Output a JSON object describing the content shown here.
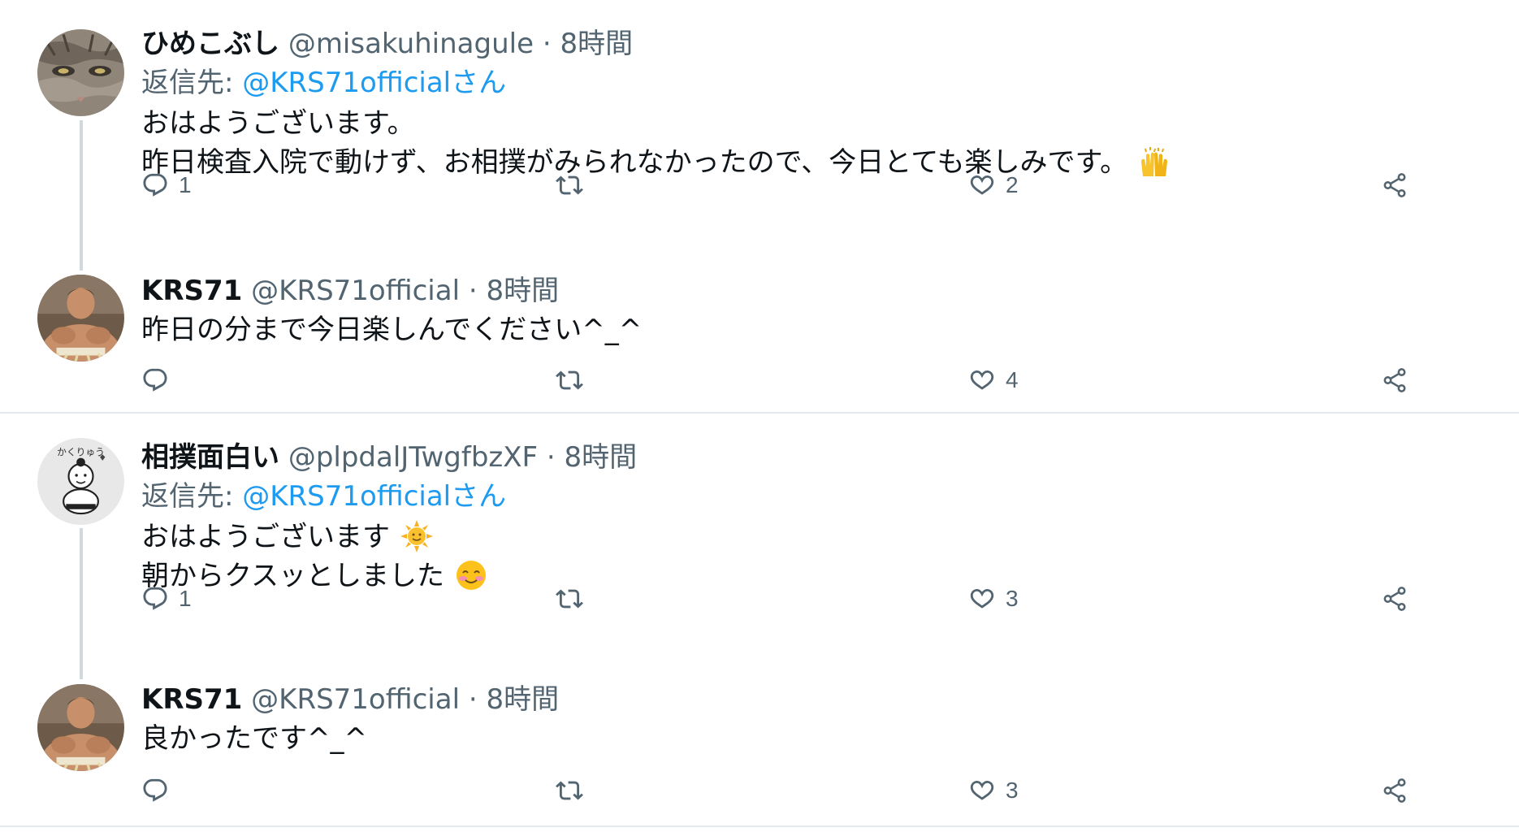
{
  "tweets": [
    {
      "name": "ひめこぶし",
      "handle": "@misakuhinagule",
      "sep": "·",
      "time": "8時間",
      "reply_prefix": "返信先: ",
      "reply_mention": "@KRS71officialさん",
      "lines": [
        "おはようございます。",
        "昨日検査入院で動けず、お相撲がみられなかったので、今日とても楽しみです。"
      ],
      "emoji": "raising-hands-emoji",
      "reply_count": "1",
      "like_count": "2",
      "avatar": "cat-avatar"
    },
    {
      "name": "KRS71",
      "handle": "@KRS71official",
      "sep": "·",
      "time": "8時間",
      "lines": [
        "昨日の分まで今日楽しんでください^_^"
      ],
      "reply_count": "",
      "like_count": "4",
      "avatar": "sumo-wrestler-avatar"
    },
    {
      "name": "相撲面白い",
      "handle": "@plpdalJTwgfbzXF",
      "sep": "·",
      "time": "8時間",
      "reply_prefix": "返信先: ",
      "reply_mention": "@KRS71officialさん",
      "lines": [
        "おはようございます",
        "朝からクスッとしました"
      ],
      "emojis": [
        "sun-emoji",
        "smiling-face-emoji"
      ],
      "reply_count": "1",
      "like_count": "3",
      "avatar": "sumo-drawing-avatar",
      "avatar_text": "かくりゅう"
    },
    {
      "name": "KRS71",
      "handle": "@KRS71official",
      "sep": "·",
      "time": "8時間",
      "lines": [
        "良かったです^_^"
      ],
      "reply_count": "",
      "like_count": "3",
      "avatar": "sumo-wrestler-avatar"
    }
  ],
  "icons": {
    "reply": "reply-icon",
    "retweet": "retweet-icon",
    "like": "like-icon",
    "share": "share-icon"
  },
  "colors": {
    "link": "#1d9bf0",
    "secondary": "#536471",
    "thread_line": "#cfd9de",
    "divider": "#e6e9ec"
  }
}
